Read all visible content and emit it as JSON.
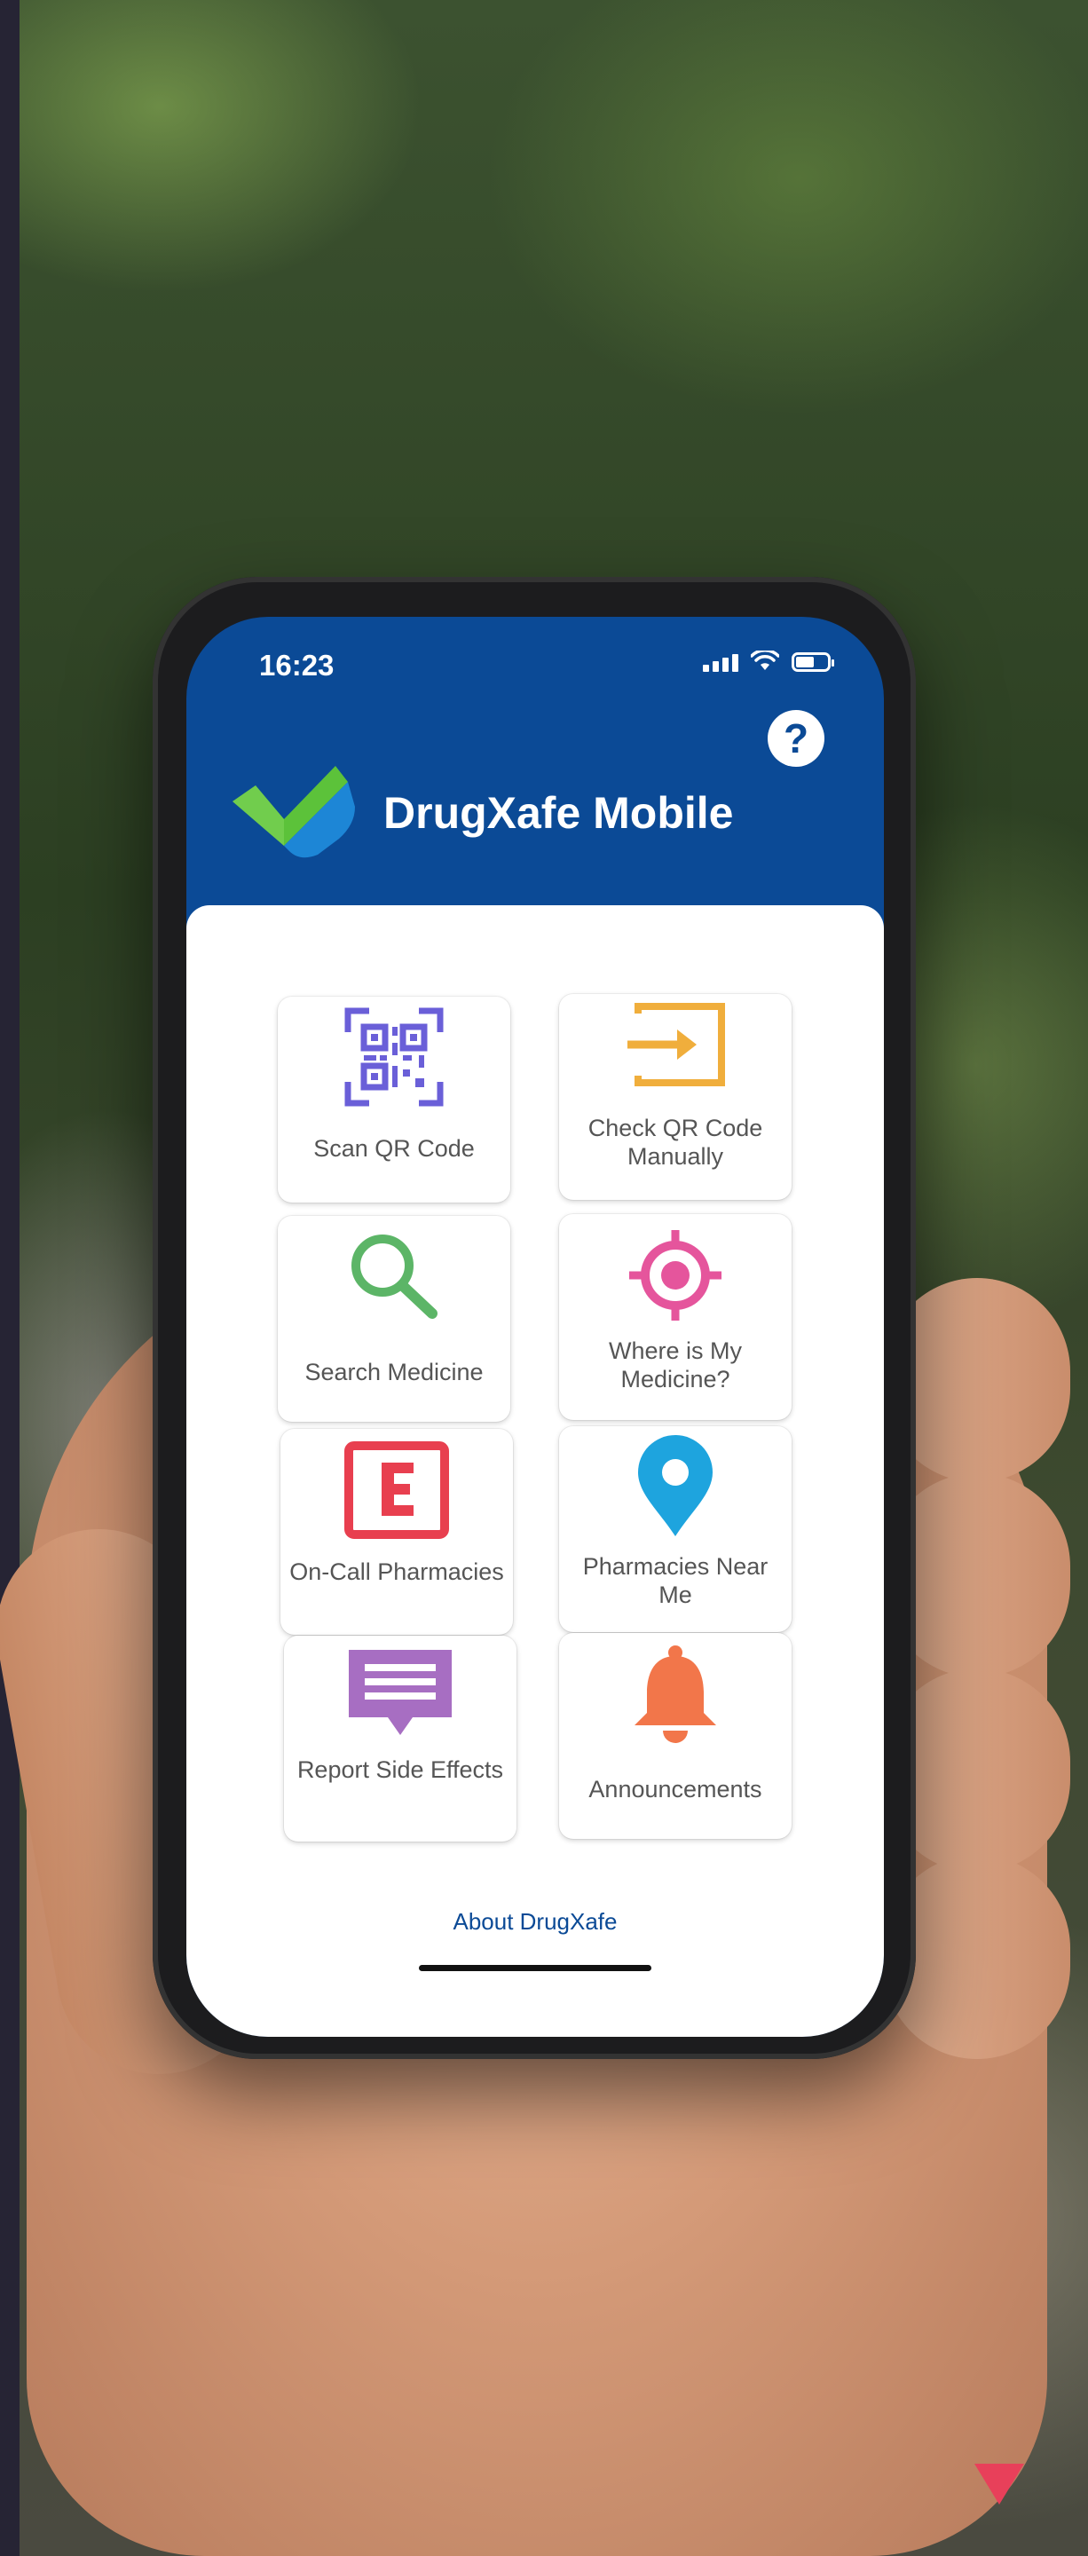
{
  "status_bar": {
    "time": "16:23"
  },
  "header": {
    "title": "DrugXafe Mobile",
    "help_icon": "question-mark-icon"
  },
  "tiles": [
    {
      "label": "Scan QR Code",
      "icon": "qr-code-icon",
      "color": "#6a5fd8"
    },
    {
      "label": "Check QR Code Manually",
      "icon": "manual-entry-icon",
      "color": "#f0ae3c"
    },
    {
      "label": "Search Medicine",
      "icon": "search-icon",
      "color": "#5cb567"
    },
    {
      "label": "Where is My Medicine?",
      "icon": "locate-icon",
      "color": "#e5559c"
    },
    {
      "label": "On-Call Pharmacies",
      "icon": "emergency-pharmacy-icon",
      "color": "#e83f4f"
    },
    {
      "label": "Pharmacies Near Me",
      "icon": "location-pin-icon",
      "color": "#1ea4de"
    },
    {
      "label": "Report Side Effects",
      "icon": "report-message-icon",
      "color": "#a76ec2"
    },
    {
      "label": "Announcements",
      "icon": "bell-icon",
      "color": "#f2764a"
    }
  ],
  "footer": {
    "about_link": "About DrugXafe"
  },
  "colors": {
    "header_blue": "#0b4a96",
    "logo_green": "#5cc23a",
    "logo_blue": "#1d86d6"
  }
}
